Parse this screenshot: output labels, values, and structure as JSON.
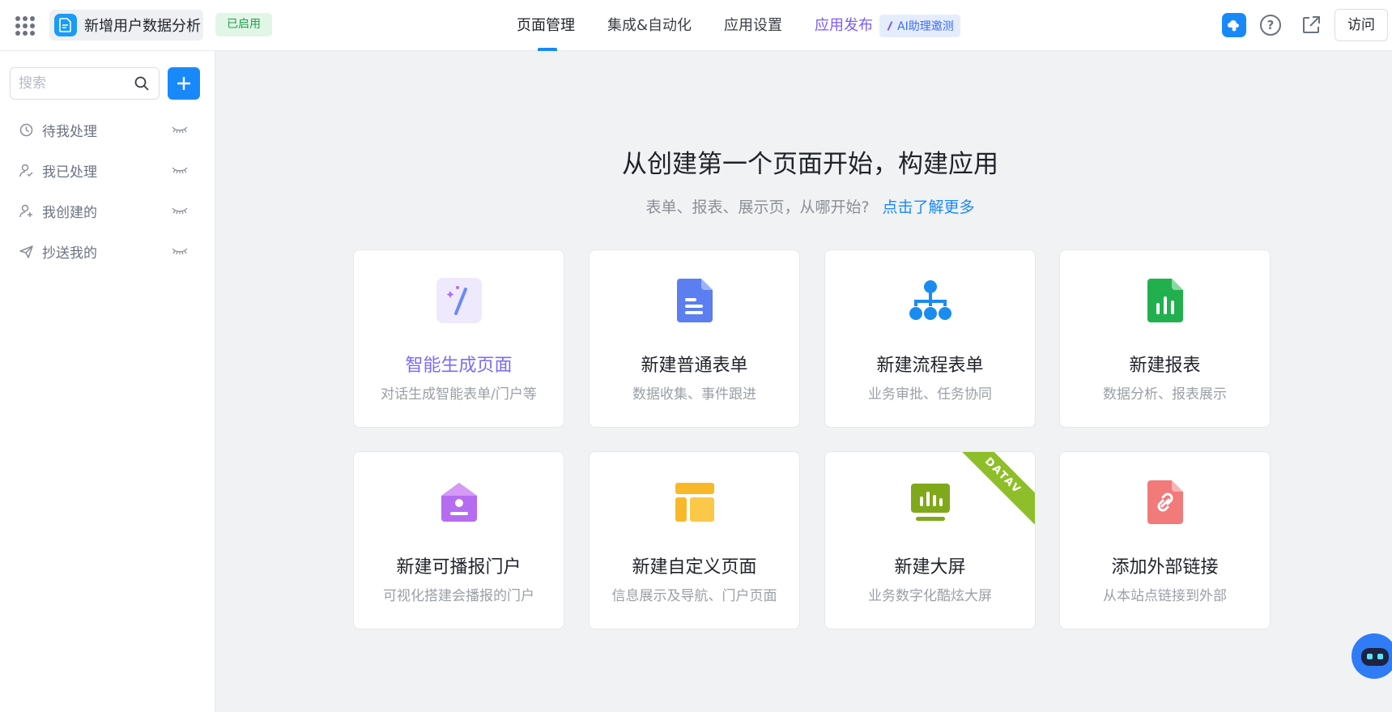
{
  "header": {
    "app_name": "新增用户数据分析",
    "status_badge": "已启用",
    "nav": [
      "页面管理",
      "集成&自动化",
      "应用设置",
      "应用发布"
    ],
    "ai_tag": "AI助理邀测",
    "visit_label": "访问",
    "help_label": "?"
  },
  "sidebar": {
    "search_placeholder": "搜索",
    "items": [
      {
        "label": "待我处理",
        "icon": "clock-icon"
      },
      {
        "label": "我已处理",
        "icon": "user-check-icon"
      },
      {
        "label": "我创建的",
        "icon": "user-add-icon"
      },
      {
        "label": "抄送我的",
        "icon": "send-icon"
      }
    ]
  },
  "main": {
    "title": "从创建第一个页面开始，构建应用",
    "subtitle": "表单、报表、展示页，从哪开始?",
    "learn_more": "点击了解更多",
    "cards": [
      {
        "title": "智能生成页面",
        "desc": "对话生成智能表单/门户等",
        "icon": "magic-wand-icon"
      },
      {
        "title": "新建普通表单",
        "desc": "数据收集、事件跟进",
        "icon": "form-document-icon"
      },
      {
        "title": "新建流程表单",
        "desc": "业务审批、任务协同",
        "icon": "org-flow-icon"
      },
      {
        "title": "新建报表",
        "desc": "数据分析、报表展示",
        "icon": "report-chart-icon"
      },
      {
        "title": "新建可播报门户",
        "desc": "可视化搭建会播报的门户",
        "icon": "home-portal-icon"
      },
      {
        "title": "新建自定义页面",
        "desc": "信息展示及导航、门户页面",
        "icon": "layout-page-icon"
      },
      {
        "title": "新建大屏",
        "desc": "业务数字化酷炫大屏",
        "icon": "big-screen-icon",
        "ribbon": "DATAV"
      },
      {
        "title": "添加外部链接",
        "desc": "从本站点链接到外部",
        "icon": "external-link-icon"
      }
    ]
  },
  "colors": {
    "accent": "#1989fa",
    "badge_green": "#21a04a",
    "ai_purple": "#7b5cf5"
  }
}
